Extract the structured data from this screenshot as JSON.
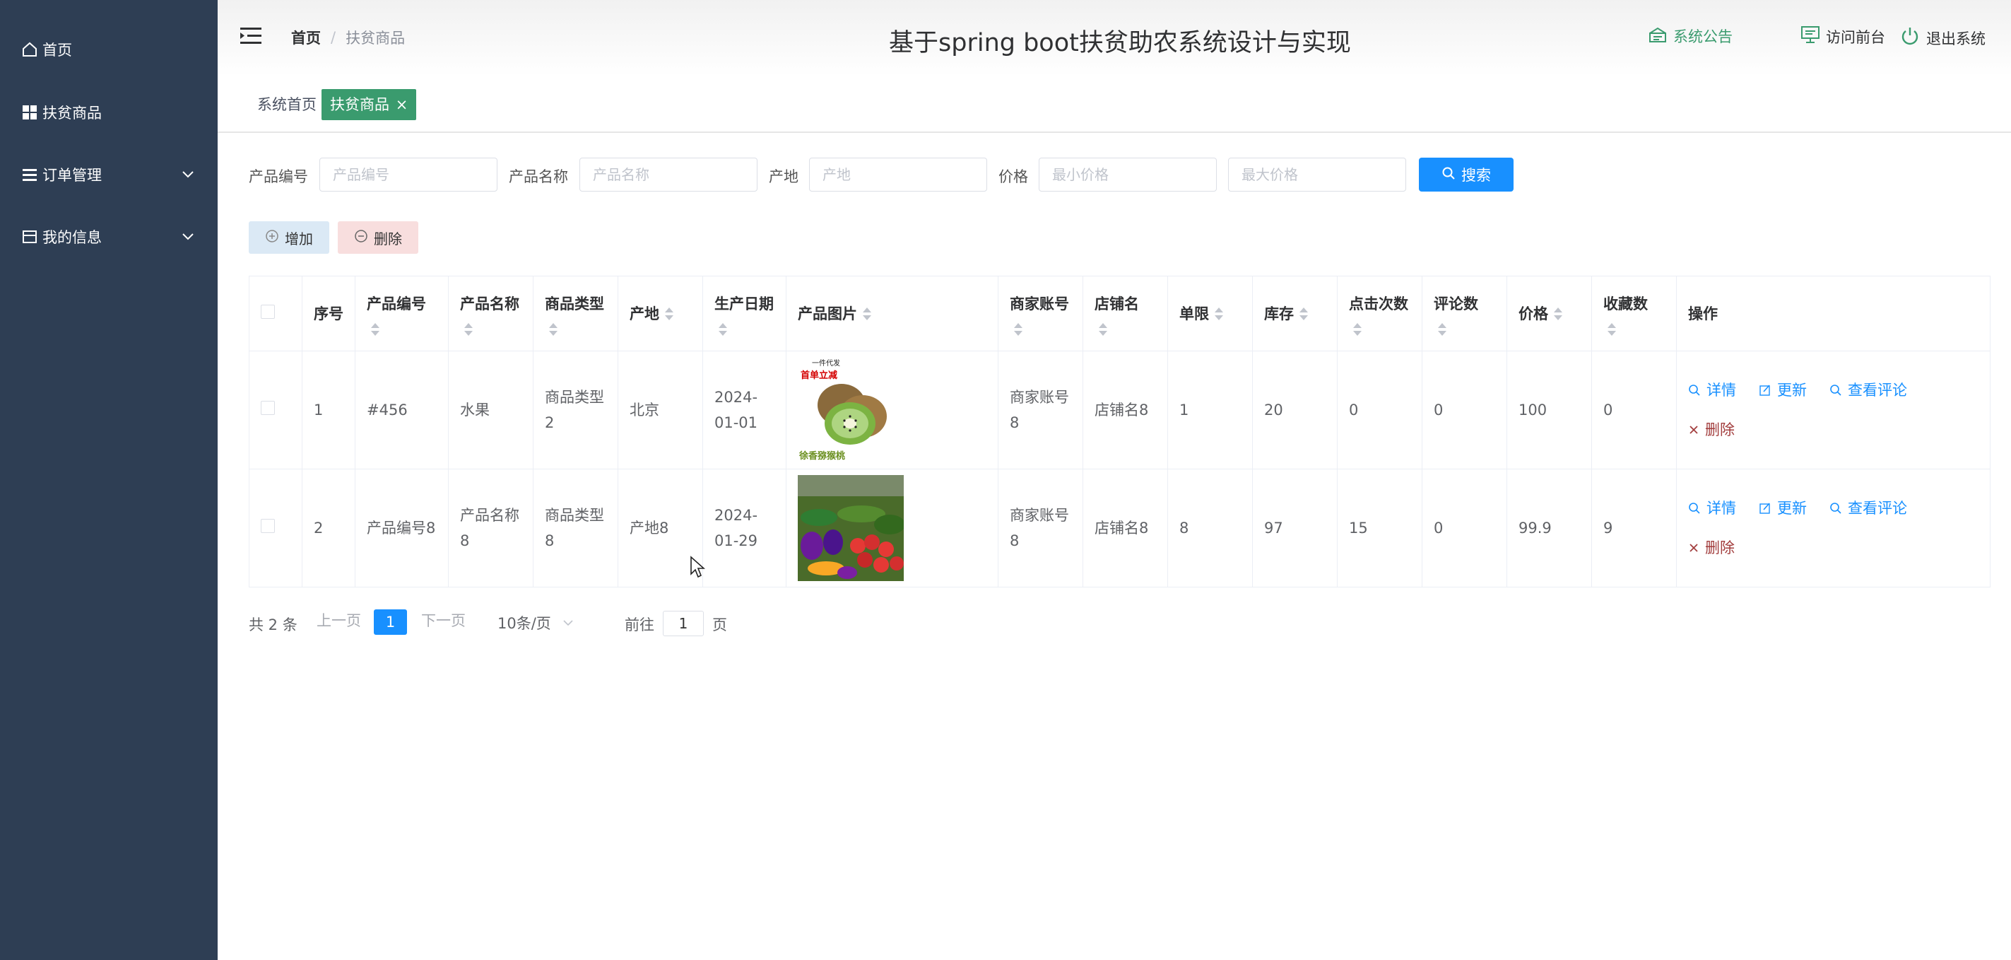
{
  "sidebar": {
    "items": [
      {
        "label": "首页",
        "icon": "home-icon"
      },
      {
        "label": "扶贫商品",
        "icon": "grid-icon"
      },
      {
        "label": "订单管理",
        "icon": "list-icon",
        "expandable": true
      },
      {
        "label": "我的信息",
        "icon": "card-icon",
        "expandable": true
      }
    ]
  },
  "header": {
    "breadcrumb_home": "首页",
    "breadcrumb_sep": "/",
    "breadcrumb_current": "扶贫商品",
    "title": "基于spring boot扶贫助农系统设计与实现",
    "notice": "系统公告",
    "frontend": "访问前台",
    "logout": "退出系统"
  },
  "tabs": {
    "home": "系统首页",
    "current": "扶贫商品",
    "close": "×"
  },
  "search": {
    "code_label": "产品编号",
    "code_placeholder": "产品编号",
    "name_label": "产品名称",
    "name_placeholder": "产品名称",
    "origin_label": "产地",
    "origin_placeholder": "产地",
    "price_label": "价格",
    "min_placeholder": "最小价格",
    "max_placeholder": "最大价格",
    "button": "搜索"
  },
  "actions": {
    "add": "增加",
    "delete": "删除"
  },
  "table": {
    "headers": {
      "index": "序号",
      "code": "产品编号",
      "name": "产品名称",
      "type": "商品类型",
      "origin": "产地",
      "date": "生产日期",
      "image": "产品图片",
      "merchant": "商家账号",
      "shop": "店铺名",
      "limit": "单限",
      "stock": "库存",
      "clicks": "点击次数",
      "reviews": "评论数",
      "price": "价格",
      "favorites": "收藏数",
      "ops": "操作"
    },
    "rows": [
      {
        "index": "1",
        "code": "#456",
        "name": "水果",
        "type": "商品类型2",
        "origin": "北京",
        "date": "2024-01-01",
        "image_caption_top": "一件代发",
        "image_caption_mid": "首单立减",
        "image_caption_bottom": "徐香猕猴桃",
        "merchant": "商家账号8",
        "shop": "店铺名8",
        "limit": "1",
        "stock": "20",
        "clicks": "0",
        "reviews": "0",
        "price": "100",
        "favorites": "0"
      },
      {
        "index": "2",
        "code": "产品编号8",
        "name": "产品名称8",
        "type": "商品类型8",
        "origin": "产地8",
        "date": "2024-01-29",
        "merchant": "商家账号8",
        "shop": "店铺名8",
        "limit": "8",
        "stock": "97",
        "clicks": "15",
        "reviews": "0",
        "price": "99.9",
        "favorites": "9"
      }
    ],
    "ops": {
      "detail": "详情",
      "update": "更新",
      "reviews": "查看评论",
      "delete": "删除"
    }
  },
  "pagination": {
    "total": "共 2 条",
    "prev": "上一页",
    "current": "1",
    "next": "下一页",
    "page_size": "10条/页",
    "goto": "前往",
    "goto_value": "1",
    "page_unit": "页"
  },
  "colors": {
    "sidebar_bg": "#2e3e54",
    "accent_green": "#3a9b6e",
    "primary_blue": "#1890ff",
    "danger_red": "#a23d3d"
  }
}
